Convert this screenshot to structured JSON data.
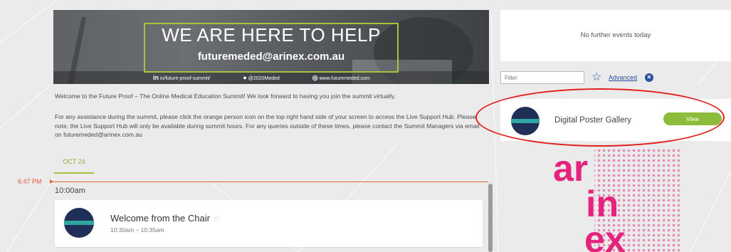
{
  "banner": {
    "title": "WE ARE HERE TO HELP",
    "email": "futuremeded@arinex.com.au",
    "linkedin": "in/future-proof-summit/",
    "twitter": "@2020Meded",
    "website": "www.futuremeded.com"
  },
  "welcome_text": "Welcome to the Future Proof – The Online Medical Education Summit! We look forward to having you join the summit virtually.",
  "help_text": "For any assistance during the summit, please click the orange person icon on the top right hand side of your screen to access the Live Support Hub. Please note, the Live Support Hub will only be available during summit hours. For any queries outside of these times, please contact the Summit Managers via email on futuremeded@arinex.com.au",
  "schedule": {
    "date_tab": "OCT 24",
    "current_time": "6:47 PM",
    "slot_time": "10:00am",
    "event": {
      "title": "Welcome from the Chair",
      "time": "10:30am – 10:35am"
    }
  },
  "sidebar": {
    "no_events": "No further events today",
    "filter_placeholder": "Filter",
    "advanced_label": "Advanced",
    "poster": {
      "title": "Digital Poster Gallery",
      "button": "View"
    }
  },
  "logo": {
    "text": "arinex",
    "color": "#e5237d"
  },
  "colors": {
    "accent_green": "#8dbb3c",
    "link_blue": "#2a4e9e",
    "timeline_orange": "#e3663a",
    "annotation_red": "#e41e1e"
  }
}
